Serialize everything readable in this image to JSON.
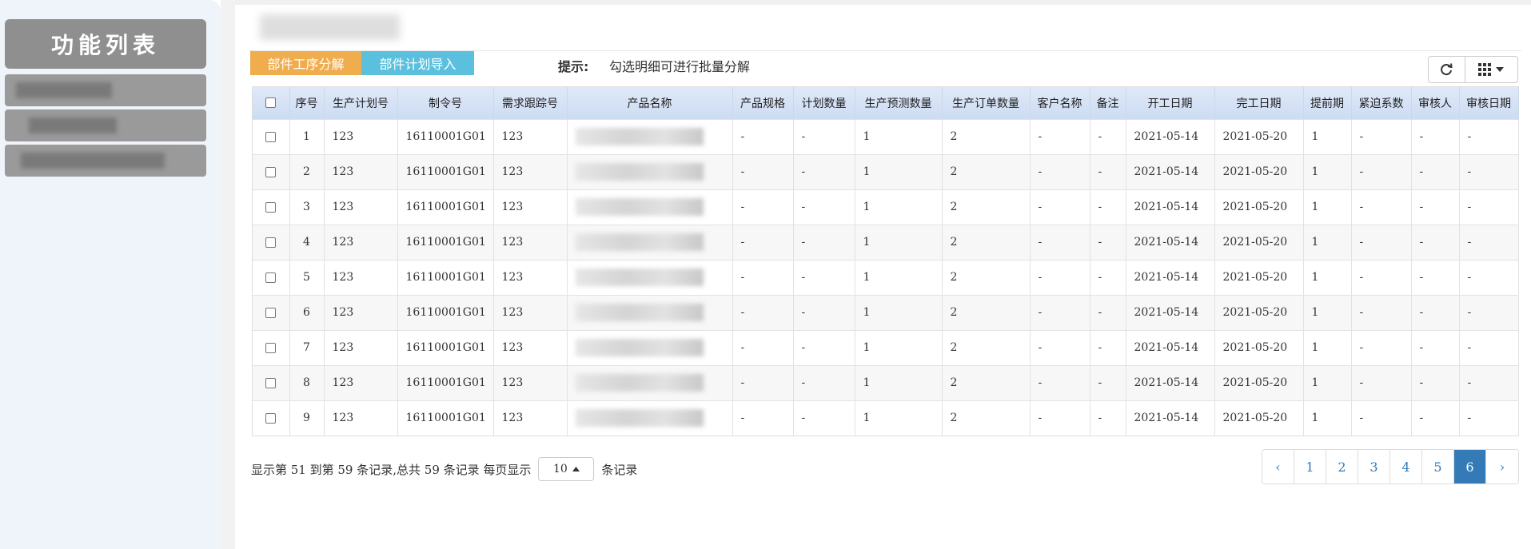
{
  "sidebar": {
    "title": "功能列表"
  },
  "toolbar": {
    "decompose_label": "部件工序分解",
    "import_label": "部件计划导入",
    "hint_label": "提示:",
    "hint_text": "勾选明细可进行批量分解"
  },
  "table": {
    "columns": [
      "序号",
      "生产计划号",
      "制令号",
      "需求跟踪号",
      "产品名称",
      "产品规格",
      "计划数量",
      "生产预测数量",
      "生产订单数量",
      "客户名称",
      "备注",
      "开工日期",
      "完工日期",
      "提前期",
      "紧迫系数",
      "审核人",
      "审核日期"
    ],
    "rows": [
      {
        "no": "1",
        "plan": "123",
        "order": "16110001G01",
        "track": "123",
        "spec": "-",
        "qty": "-",
        "forecast": "1",
        "prod": "2",
        "customer": "-",
        "remark": "-",
        "start": "2021-05-14",
        "end": "2021-05-20",
        "lead": "1",
        "urgency": "-",
        "reviewer": "-",
        "review_date": "-"
      },
      {
        "no": "2",
        "plan": "123",
        "order": "16110001G01",
        "track": "123",
        "spec": "-",
        "qty": "-",
        "forecast": "1",
        "prod": "2",
        "customer": "-",
        "remark": "-",
        "start": "2021-05-14",
        "end": "2021-05-20",
        "lead": "1",
        "urgency": "-",
        "reviewer": "-",
        "review_date": "-"
      },
      {
        "no": "3",
        "plan": "123",
        "order": "16110001G01",
        "track": "123",
        "spec": "-",
        "qty": "-",
        "forecast": "1",
        "prod": "2",
        "customer": "-",
        "remark": "-",
        "start": "2021-05-14",
        "end": "2021-05-20",
        "lead": "1",
        "urgency": "-",
        "reviewer": "-",
        "review_date": "-"
      },
      {
        "no": "4",
        "plan": "123",
        "order": "16110001G01",
        "track": "123",
        "spec": "-",
        "qty": "-",
        "forecast": "1",
        "prod": "2",
        "customer": "-",
        "remark": "-",
        "start": "2021-05-14",
        "end": "2021-05-20",
        "lead": "1",
        "urgency": "-",
        "reviewer": "-",
        "review_date": "-"
      },
      {
        "no": "5",
        "plan": "123",
        "order": "16110001G01",
        "track": "123",
        "spec": "-",
        "qty": "-",
        "forecast": "1",
        "prod": "2",
        "customer": "-",
        "remark": "-",
        "start": "2021-05-14",
        "end": "2021-05-20",
        "lead": "1",
        "urgency": "-",
        "reviewer": "-",
        "review_date": "-"
      },
      {
        "no": "6",
        "plan": "123",
        "order": "16110001G01",
        "track": "123",
        "spec": "-",
        "qty": "-",
        "forecast": "1",
        "prod": "2",
        "customer": "-",
        "remark": "-",
        "start": "2021-05-14",
        "end": "2021-05-20",
        "lead": "1",
        "urgency": "-",
        "reviewer": "-",
        "review_date": "-"
      },
      {
        "no": "7",
        "plan": "123",
        "order": "16110001G01",
        "track": "123",
        "spec": "-",
        "qty": "-",
        "forecast": "1",
        "prod": "2",
        "customer": "-",
        "remark": "-",
        "start": "2021-05-14",
        "end": "2021-05-20",
        "lead": "1",
        "urgency": "-",
        "reviewer": "-",
        "review_date": "-"
      },
      {
        "no": "8",
        "plan": "123",
        "order": "16110001G01",
        "track": "123",
        "spec": "-",
        "qty": "-",
        "forecast": "1",
        "prod": "2",
        "customer": "-",
        "remark": "-",
        "start": "2021-05-14",
        "end": "2021-05-20",
        "lead": "1",
        "urgency": "-",
        "reviewer": "-",
        "review_date": "-"
      },
      {
        "no": "9",
        "plan": "123",
        "order": "16110001G01",
        "track": "123",
        "spec": "-",
        "qty": "-",
        "forecast": "1",
        "prod": "2",
        "customer": "-",
        "remark": "-",
        "start": "2021-05-14",
        "end": "2021-05-20",
        "lead": "1",
        "urgency": "-",
        "reviewer": "-",
        "review_date": "-"
      }
    ]
  },
  "footer": {
    "info_prefix": "显示第 51 到第 59 条记录,总共 59 条记录 每页显示",
    "page_size": "10",
    "info_suffix": "条记录"
  },
  "pagination": {
    "prev": "‹",
    "pages": [
      "1",
      "2",
      "3",
      "4",
      "5",
      "6"
    ],
    "active": "6",
    "next": "›"
  },
  "icons": {
    "refresh": "refresh-icon",
    "columns": "columns-grid-icon",
    "caret": "caret-down-icon"
  }
}
